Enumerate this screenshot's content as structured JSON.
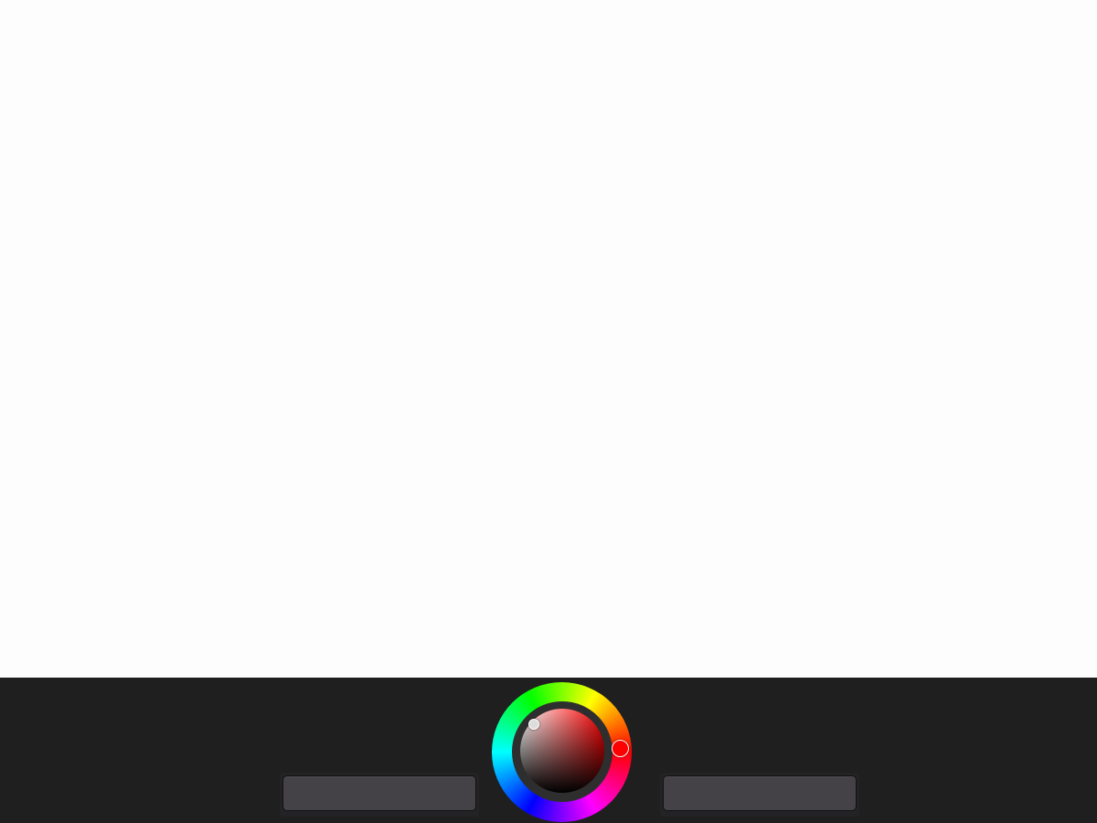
{
  "canvas": {
    "background": "#fdfdfd"
  },
  "toolbar": {
    "background": "#1f1f1f",
    "left_button_label": "",
    "right_button_label": ""
  },
  "color_picker": {
    "current_color": "#ff0000",
    "hue_degrees": 0,
    "saturation": 0.05,
    "brightness": 0.95
  }
}
